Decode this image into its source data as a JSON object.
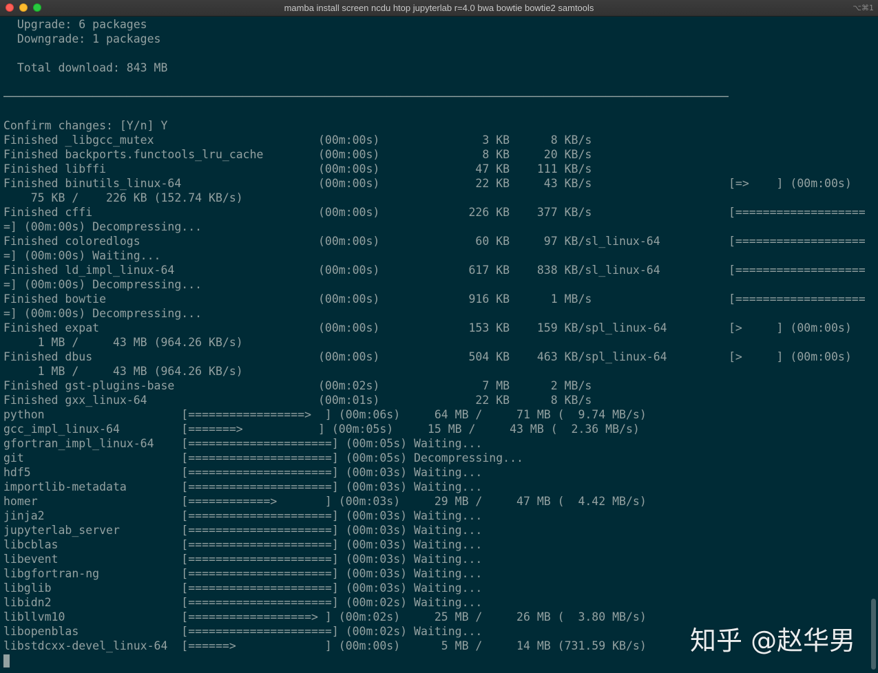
{
  "window": {
    "title": "mamba install screen ncdu htop jupyterlab r=4.0 bwa bowtie bowtie2 samtools",
    "shortcut": "⌥⌘1"
  },
  "terminal": {
    "lines": [
      "  Upgrade: 6 packages",
      "  Downgrade: 1 packages",
      "",
      "  Total download: 843 MB",
      "",
      "──────────────────────────────────────────────────────────────────────────────────────────────────────────",
      "",
      "Confirm changes: [Y/n] Y",
      "Finished _libgcc_mutex                        (00m:00s)               3 KB      8 KB/s",
      "Finished backports.functools_lru_cache        (00m:00s)               8 KB     20 KB/s",
      "Finished libffi                               (00m:00s)              47 KB    111 KB/s",
      "Finished binutils_linux-64                    (00m:00s)              22 KB     43 KB/s                    [=>    ] (00m:00s)",
      "    75 KB /    226 KB (152.74 KB/s)",
      "Finished cffi                                 (00m:00s)             226 KB    377 KB/s                    [====================",
      "=] (00m:00s) Decompressing...",
      "Finished coloredlogs                          (00m:00s)              60 KB     97 KB/sl_linux-64          [====================",
      "=] (00m:00s) Waiting...",
      "Finished ld_impl_linux-64                     (00m:00s)             617 KB    838 KB/sl_linux-64          [====================",
      "=] (00m:00s) Decompressing...",
      "Finished bowtie                               (00m:00s)             916 KB      1 MB/s                    [====================",
      "=] (00m:00s) Decompressing...",
      "Finished expat                                (00m:00s)             153 KB    159 KB/spl_linux-64         [>     ] (00m:00s)",
      "     1 MB /     43 MB (964.26 KB/s)",
      "Finished dbus                                 (00m:00s)             504 KB    463 KB/spl_linux-64         [>     ] (00m:00s)",
      "     1 MB /     43 MB (964.26 KB/s)",
      "Finished gst-plugins-base                     (00m:02s)               7 MB      2 MB/s",
      "Finished gxx_linux-64                         (00m:01s)              22 KB      8 KB/s",
      "python                    [=================>  ] (00m:06s)     64 MB /     71 MB (  9.74 MB/s)",
      "gcc_impl_linux-64         [=======>           ] (00m:05s)     15 MB /     43 MB (  2.36 MB/s)",
      "gfortran_impl_linux-64    [=====================] (00m:05s) Waiting...",
      "git                       [=====================] (00m:05s) Decompressing...",
      "hdf5                      [=====================] (00m:03s) Waiting...",
      "importlib-metadata        [=====================] (00m:03s) Waiting...",
      "homer                     [============>       ] (00m:03s)     29 MB /     47 MB (  4.42 MB/s)",
      "jinja2                    [=====================] (00m:03s) Waiting...",
      "jupyterlab_server         [=====================] (00m:03s) Waiting...",
      "libcblas                  [=====================] (00m:03s) Waiting...",
      "libevent                  [=====================] (00m:03s) Waiting...",
      "libgfortran-ng            [=====================] (00m:03s) Waiting...",
      "libglib                   [=====================] (00m:03s) Waiting...",
      "libidn2                   [=====================] (00m:02s) Waiting...",
      "libllvm10                 [==================> ] (00m:02s)     25 MB /     26 MB (  3.80 MB/s)",
      "libopenblas               [=====================] (00m:02s) Waiting...",
      "libstdcxx-devel_linux-64  [======>             ] (00m:00s)      5 MB /     14 MB (731.59 KB/s)"
    ]
  },
  "watermark": "知乎 @赵华男"
}
